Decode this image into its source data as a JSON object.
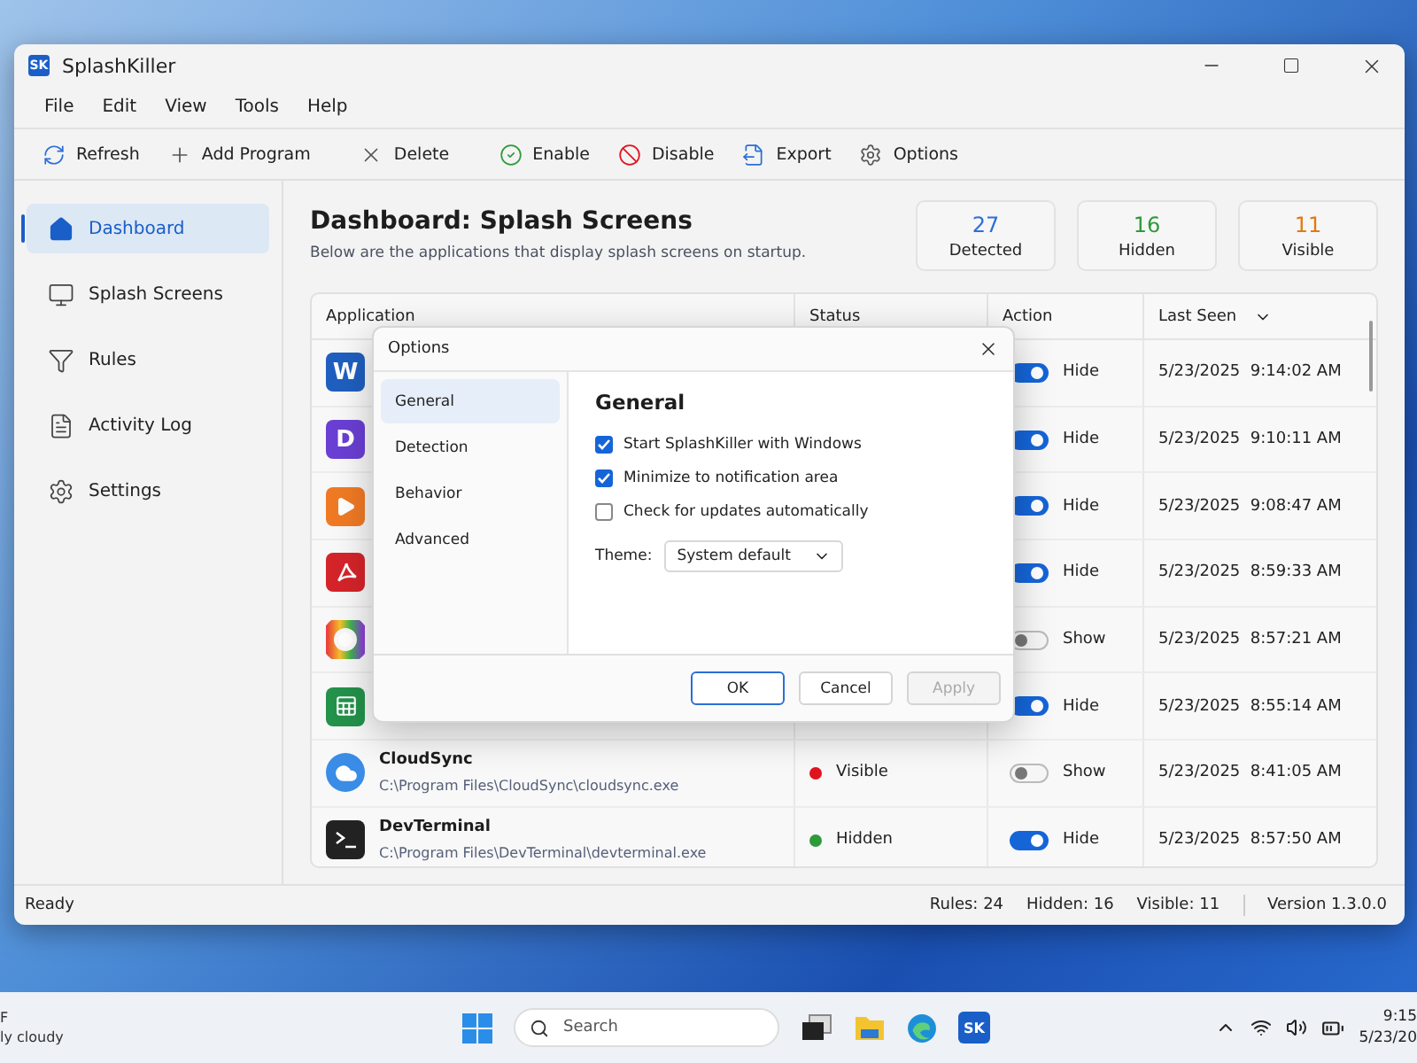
{
  "window": {
    "logo": "SK",
    "title": "SplashKiller"
  },
  "menu": [
    "File",
    "Edit",
    "View",
    "Tools",
    "Help"
  ],
  "toolbar": [
    {
      "kind": "refresh",
      "label": "Refresh"
    },
    {
      "kind": "add",
      "label": "Add Program"
    },
    {
      "kind": "delete",
      "label": "Delete"
    },
    {
      "kind": "enable",
      "label": "Enable"
    },
    {
      "kind": "disable",
      "label": "Disable"
    },
    {
      "kind": "export",
      "label": "Export"
    },
    {
      "kind": "options",
      "label": "Options"
    }
  ],
  "sidebar": {
    "items": [
      {
        "kind": "home",
        "label": "Dashboard",
        "selected": true
      },
      {
        "kind": "monitor",
        "label": "Splash Screens",
        "selected": false
      },
      {
        "kind": "filter",
        "label": "Rules",
        "selected": false
      },
      {
        "kind": "log",
        "label": "Activity Log",
        "selected": false
      },
      {
        "kind": "settings",
        "label": "Settings",
        "selected": false
      }
    ]
  },
  "header": {
    "title": "Dashboard: Splash Screens",
    "subtitle": "Below are the applications that display splash screens on startup."
  },
  "stats": [
    {
      "value": "27",
      "label": "Detected",
      "color": "#2f6fd6"
    },
    {
      "value": "16",
      "label": "Hidden",
      "color": "#2e9a3a"
    },
    {
      "value": "11",
      "label": "Visible",
      "color": "#e07a12"
    }
  ],
  "table": {
    "columns": [
      "Application",
      "Status",
      "Action",
      "Last Seen"
    ],
    "rows": [
      {
        "kind": "word",
        "icon_letter": "W",
        "on": true,
        "action": "Hide",
        "last_seen": "5/23/2025  9:14:02 AM"
      },
      {
        "kind": "letter",
        "icon_letter": "D",
        "on": true,
        "action": "Hide",
        "last_seen": "5/23/2025  9:10:11 AM"
      },
      {
        "kind": "play",
        "on": true,
        "action": "Hide",
        "last_seen": "5/23/2025  9:08:47 AM"
      },
      {
        "kind": "pdf",
        "on": true,
        "action": "Hide",
        "last_seen": "5/23/2025  8:59:33 AM"
      },
      {
        "kind": "wheel",
        "on": false,
        "action": "Show",
        "last_seen": "5/23/2025  8:57:21 AM"
      },
      {
        "kind": "sheet",
        "on": true,
        "action": "Hide",
        "last_seen": "5/23/2025  8:55:14 AM"
      },
      {
        "kind": "cloud",
        "name": "CloudSync",
        "path": "C:\\Program Files\\CloudSync\\cloudsync.exe",
        "status": "Visible",
        "color": "#e0141e",
        "on": false,
        "action": "Show",
        "last_seen": "5/23/2025  8:41:05 AM"
      },
      {
        "kind": "terminal",
        "name": "DevTerminal",
        "path": "C:\\Program Files\\DevTerminal\\devterminal.exe",
        "status": "Hidden",
        "color": "#2e9a3a",
        "on": true,
        "action": "Hide",
        "last_seen": "5/23/2025  8:57:50 AM"
      }
    ]
  },
  "status_bar": {
    "left": "Ready",
    "items": [
      "Rules: 24",
      "Hidden: 16",
      "Visible: 11"
    ],
    "version": "Version 1.3.0.0"
  },
  "dialog": {
    "title": "Options",
    "nav": [
      {
        "label": "General",
        "selected": true
      },
      {
        "label": "Detection",
        "selected": false
      },
      {
        "label": "Behavior",
        "selected": false
      },
      {
        "label": "Advanced",
        "selected": false
      }
    ],
    "heading": "General",
    "checks": [
      {
        "label": "Start SplashKiller with Windows",
        "checked": true
      },
      {
        "label": "Minimize to notification area",
        "checked": true
      },
      {
        "label": "Check for updates automatically",
        "checked": false
      }
    ],
    "theme_label": "Theme:",
    "theme_value": "System default",
    "buttons": [
      {
        "label": "OK",
        "kind": "primary",
        "disabled": false
      },
      {
        "label": "Cancel",
        "kind": "normal",
        "disabled": false
      },
      {
        "label": "Apply",
        "kind": "normal",
        "disabled": true
      }
    ]
  },
  "taskbar": {
    "weather": [
      "F",
      "ly cloudy"
    ],
    "search": "Search",
    "app_logo": "SK",
    "time": "9:15",
    "date": "5/23/20"
  }
}
